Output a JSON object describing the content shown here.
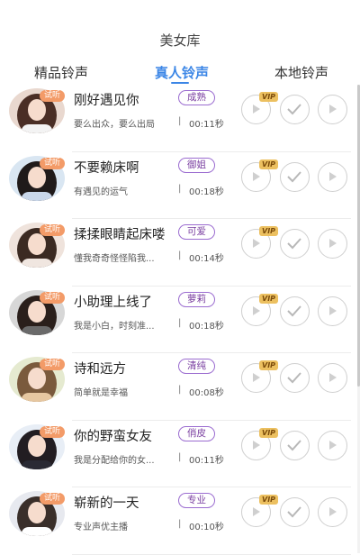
{
  "header": {
    "title": "美女库"
  },
  "tabs": [
    {
      "label": "精品铃声",
      "active": false
    },
    {
      "label": "真人铃声",
      "active": true
    },
    {
      "label": "本地铃声",
      "active": false
    }
  ],
  "colors": {
    "accent": "#3b86e6",
    "tag_border": "#9b6cd0",
    "trial_badge": "#f39b68",
    "vip_badge": "#ecc060"
  },
  "trial_label": "试听",
  "vip_label": "VIP",
  "items": [
    {
      "name": "刚好遇见你",
      "tag": "成熟",
      "subtitle": "要么出众，要么出局",
      "separator": "|",
      "duration": "00:11秒"
    },
    {
      "name": "不要赖床啊",
      "tag": "御姐",
      "subtitle": "有遇见的运气",
      "separator": "|",
      "duration": "00:18秒"
    },
    {
      "name": "揉揉眼睛起床喽",
      "tag": "可爱",
      "subtitle": "懂我奇奇怪怪陷我...",
      "separator": "|",
      "duration": "00:14秒"
    },
    {
      "name": "小助理上线了",
      "tag": "萝莉",
      "subtitle": "我是小白，时刻准...",
      "separator": "|",
      "duration": "00:18秒"
    },
    {
      "name": "诗和远方",
      "tag": "清纯",
      "subtitle": "简单就是幸福",
      "separator": "|",
      "duration": "00:08秒"
    },
    {
      "name": "你的野蛮女友",
      "tag": "俏皮",
      "subtitle": "我是分配给你的女...",
      "separator": "|",
      "duration": "00:11秒"
    },
    {
      "name": "崭新的一天",
      "tag": "专业",
      "subtitle": "专业声优主播",
      "separator": "|",
      "duration": "00:10秒"
    }
  ]
}
